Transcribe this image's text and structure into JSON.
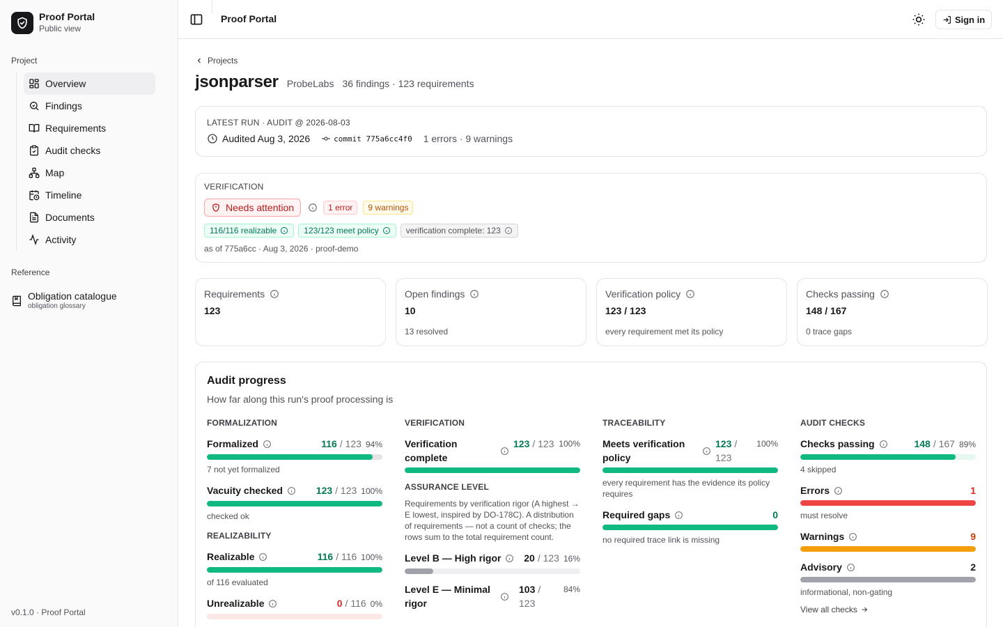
{
  "sidebar": {
    "brand_title": "Proof Portal",
    "brand_sub": "Public view",
    "project_label": "Project",
    "items": [
      {
        "label": "Overview",
        "icon": "grid-icon"
      },
      {
        "label": "Findings",
        "icon": "search-icon"
      },
      {
        "label": "Requirements",
        "icon": "book-icon"
      },
      {
        "label": "Audit checks",
        "icon": "clipboard-icon"
      },
      {
        "label": "Map",
        "icon": "network-icon"
      },
      {
        "label": "Timeline",
        "icon": "calendar-clock-icon"
      },
      {
        "label": "Documents",
        "icon": "file-icon"
      },
      {
        "label": "Activity",
        "icon": "activity-icon"
      }
    ],
    "active": "Overview",
    "reference_label": "Reference",
    "ref_title": "Obligation catalogue",
    "ref_sub": "obligation glossary",
    "version": "v0.1.0 · Proof Portal"
  },
  "header": {
    "title": "Proof Portal",
    "signin": "Sign in"
  },
  "page": {
    "breadcrumb": "Projects",
    "title": "jsonparser",
    "org": "ProbeLabs",
    "counts": "36 findings · 123 requirements"
  },
  "run": {
    "caption": "LATEST RUN · AUDIT @ 2026-08-03",
    "audited": "Audited Aug 3, 2026",
    "commit": "commit 775a6cc4f0",
    "issues": "1 errors · 9 warnings"
  },
  "verification": {
    "caption": "VERIFICATION",
    "status": "Needs attention",
    "errors": "1 error",
    "warnings": "9 warnings",
    "chip_realizable": "116/116 realizable",
    "chip_policy": "123/123 meet policy",
    "chip_complete": "verification complete: 123",
    "as_of": "as of 775a6cc · Aug 3, 2026 · proof-demo"
  },
  "stats": [
    {
      "label": "Requirements",
      "value": "123",
      "note": ""
    },
    {
      "label": "Open findings",
      "value": "10",
      "note": "13 resolved"
    },
    {
      "label": "Verification policy",
      "value": "123 / 123",
      "note": "every requirement met its policy"
    },
    {
      "label": "Checks passing",
      "value": "148 / 167",
      "note": "0 trace gaps"
    }
  ],
  "progress": {
    "title": "Audit progress",
    "subtitle": "How far along this run's proof processing is",
    "formalization": {
      "heading": "FORMALIZATION",
      "formalized": {
        "name": "Formalized",
        "num": "116",
        "den": "/ 123",
        "pct": "94%",
        "fraction": 0.943,
        "note": "7 not yet formalized"
      },
      "vacuity": {
        "name": "Vacuity checked",
        "num": "123",
        "den": "/ 123",
        "pct": "100%",
        "fraction": 1.0,
        "note": "checked ok"
      }
    },
    "realizability": {
      "heading": "REALIZABILITY",
      "realizable": {
        "name": "Realizable",
        "num": "116",
        "den": "/ 116",
        "pct": "100%",
        "fraction": 1.0,
        "note": "of 116 evaluated"
      },
      "unrealizable": {
        "name": "Unrealizable",
        "num": "0",
        "den": "/ 116",
        "pct": "0%",
        "fraction": 0.0
      }
    },
    "verification": {
      "heading": "VERIFICATION",
      "complete": {
        "name": "Verification complete",
        "num": "123",
        "den": "/ 123",
        "pct": "100%",
        "fraction": 1.0
      }
    },
    "assurance": {
      "heading": "ASSURANCE LEVEL",
      "description": "Requirements by verification rigor (A highest → E lowest, inspired by DO-178C). A distribution of requirements — not a count of checks; the rows sum to the total requirement count.",
      "level_b": {
        "name": "Level B — High rigor",
        "num": "20",
        "den": "/ 123",
        "pct": "16%",
        "fraction": 0.163
      },
      "level_e": {
        "name": "Level E — Minimal rigor",
        "num": "103",
        "den": "/ 123",
        "pct": "84%",
        "fraction": 0.837
      }
    },
    "traceability": {
      "heading": "TRACEABILITY",
      "policy": {
        "name": "Meets verification policy",
        "num": "123",
        "den": "/ 123",
        "pct": "100%",
        "fraction": 1.0,
        "note": "every requirement has the evidence its policy requires"
      },
      "gaps": {
        "name": "Required gaps",
        "num": "0",
        "fraction": 1.0,
        "note": "no required trace link is missing"
      }
    },
    "audit_checks": {
      "heading": "AUDIT CHECKS",
      "passing": {
        "name": "Checks passing",
        "num": "148",
        "den": "/ 167",
        "pct": "89%",
        "fraction": 0.886,
        "note": "4 skipped"
      },
      "errors": {
        "name": "Errors",
        "num": "1",
        "fraction": 1.0,
        "note": "must resolve"
      },
      "warnings": {
        "name": "Warnings",
        "num": "9",
        "fraction": 1.0
      },
      "advisory": {
        "name": "Advisory",
        "num": "2",
        "fraction": 1.0,
        "note": "informational, non-gating"
      },
      "view_all": "View all checks"
    }
  },
  "colors": {
    "green": "#10b981",
    "red": "#ef4444",
    "orange": "#f59e0b",
    "gray": "#a1a1aa",
    "track_red": "#fde8e8"
  }
}
